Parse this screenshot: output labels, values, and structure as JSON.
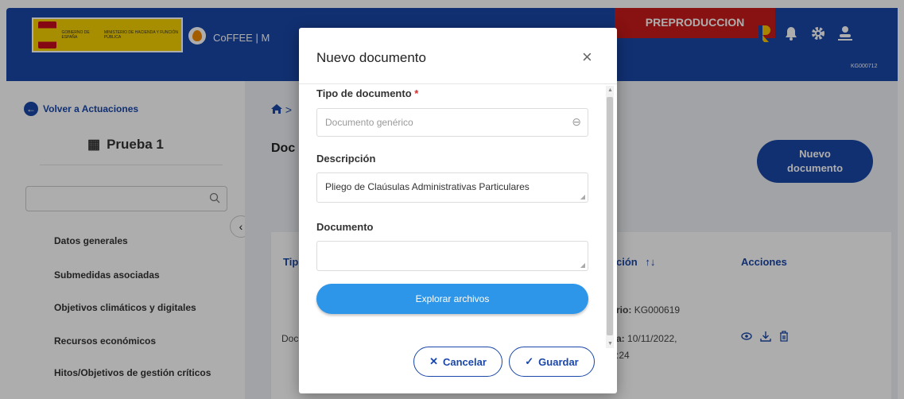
{
  "header": {
    "gov_logo_line1": "GOBIERNO DE ESPAÑA",
    "gov_logo_line2": "MINISTERIO DE HACIENDA Y FUNCIÓN PÚBLICA",
    "app_name": "CoFFEE | M",
    "environment_badge": "PREPRODUCCION",
    "user_code": "KG000712",
    "icons": [
      "logo-r-icon",
      "bell-icon",
      "gear-icon",
      "user-icon"
    ],
    "colors": {
      "primary": "#1a47a8",
      "badge": "#c91a1a"
    }
  },
  "sidebar": {
    "back_label": "Volver a Actuaciones",
    "project_title": "Prueba 1",
    "search_value": "",
    "items": [
      {
        "label": "Datos generales"
      },
      {
        "label": "Submedidas asociadas"
      },
      {
        "label": "Objetivos climáticos y digitales"
      },
      {
        "label": "Recursos económicos"
      },
      {
        "label": "Hitos/Objetivos de gestión críticos"
      }
    ]
  },
  "main": {
    "breadcrumb_tail": ">",
    "page_title_partial": "Doc",
    "new_button_line1": "Nuevo",
    "new_button_line2": "documento",
    "table": {
      "headers": {
        "tipo": "Tip",
        "descripcion": "ción",
        "sort": "↑↓",
        "acciones": "Acciones"
      },
      "row": {
        "tipo": "Doc",
        "usuario_label": "rio:",
        "usuario_value": "KG000619",
        "fecha_label": "a:",
        "fecha_value": "10/11/2022,",
        "hora_partial": ":24"
      }
    }
  },
  "modal": {
    "title": "Nuevo documento",
    "close_glyph": "×",
    "tipo_label": "Tipo de documento",
    "required_mark": "*",
    "tipo_placeholder": "Documento genérico",
    "descripcion_label": "Descripción",
    "descripcion_value": "Pliego de Claúsulas Administrativas Particulares",
    "documento_label": "Documento",
    "documento_value": "",
    "explore_label": "Explorar archivos",
    "cancel_label": "Cancelar",
    "save_label": "Guardar"
  }
}
